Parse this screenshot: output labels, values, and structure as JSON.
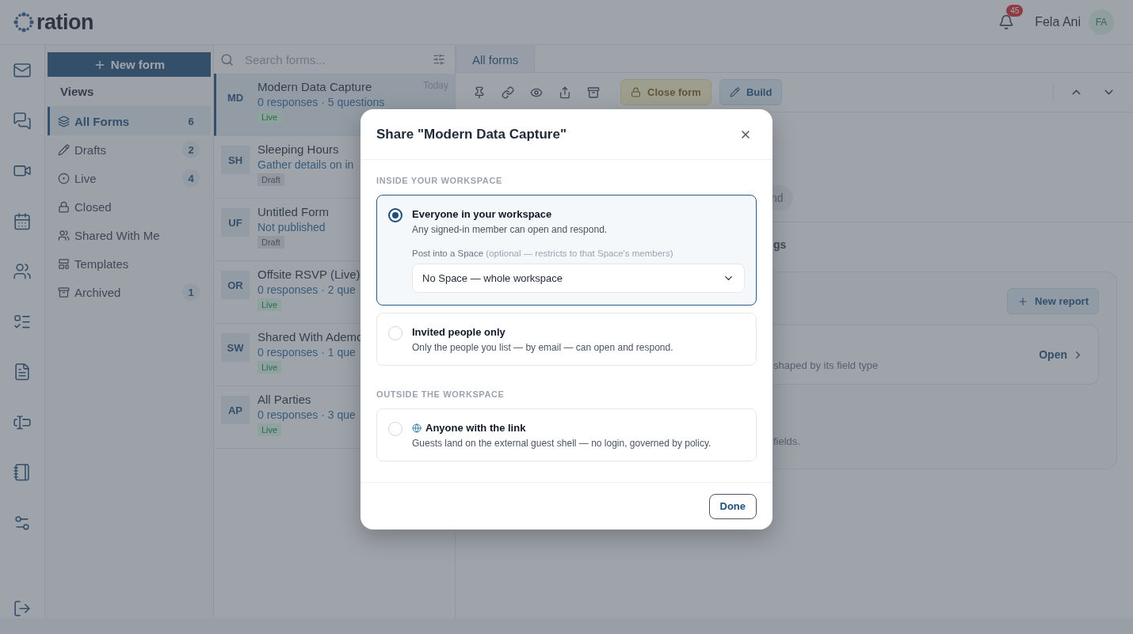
{
  "app": {
    "logo_text": "ration"
  },
  "header": {
    "notification_count": "45",
    "user": {
      "name": "Fela Ani",
      "initials": "FA"
    }
  },
  "sidebar": {
    "new_button": "New form",
    "heading": "Views",
    "items": [
      {
        "label": "All Forms",
        "count": "6",
        "selected": true
      },
      {
        "label": "Drafts",
        "count": "2",
        "selected": false
      },
      {
        "label": "Live",
        "count": "4",
        "selected": false
      },
      {
        "label": "Closed",
        "selected": false
      },
      {
        "label": "Shared With Me",
        "selected": false
      },
      {
        "label": "Templates",
        "selected": false
      },
      {
        "label": "Archived",
        "count": "1",
        "selected": false
      }
    ]
  },
  "form_list": {
    "search_placeholder": "Search forms...",
    "rows": [
      {
        "initials": "MD",
        "title": "Modern Data Capture",
        "subtitle": "0 responses · 5 questions",
        "date": "Today",
        "status": "Live",
        "kind": "live",
        "selected": true
      },
      {
        "initials": "SH",
        "title": "Sleeping Hours",
        "subtitle": "Gather details on in",
        "status": "Draft",
        "kind": "draft",
        "selected": false
      },
      {
        "initials": "UF",
        "title": "Untitled Form",
        "subtitle": "Not published",
        "status": "Draft",
        "kind": "draft",
        "selected": false
      },
      {
        "initials": "OR",
        "title": "Offsite RSVP (Live)",
        "subtitle": "0 responses · 2 que",
        "status": "Live",
        "kind": "live",
        "selected": false
      },
      {
        "initials": "SW",
        "title": "Shared With Ademo",
        "subtitle": "0 responses · 1 que",
        "status": "Live",
        "kind": "live",
        "selected": false
      },
      {
        "initials": "AP",
        "title": "All Parties",
        "subtitle": "0 responses · 3 que",
        "status": "Live",
        "kind": "live",
        "selected": false
      }
    ]
  },
  "main": {
    "tabs": [
      {
        "label": "All forms",
        "selected": true
      }
    ],
    "toolbar": {
      "close_button": "Close form",
      "build_button": "Build"
    },
    "pill_text": "nd",
    "section_text": "gs",
    "reports": {
      "new_button": "New report",
      "item_description": "shaped by its field type",
      "open_link": "Open",
      "note": "fields."
    }
  },
  "dialog": {
    "title": "Share \"Modern Data Capture\"",
    "sections": [
      {
        "heading": "INSIDE YOUR WORKSPACE",
        "options": [
          {
            "kind": "plain",
            "label": "Everyone in your workspace",
            "description": "Any signed-in member can open and respond.",
            "selected": true,
            "space": {
              "label": "Post into a Space",
              "hint": "(optional — restricts to that Space's members)",
              "value": "No Space — whole workspace"
            }
          },
          {
            "kind": "plain",
            "label": "Invited people only",
            "description": "Only the people you list — by email — can open and respond.",
            "selected": false
          }
        ]
      },
      {
        "heading": "OUTSIDE THE WORKSPACE",
        "options": [
          {
            "kind": "public",
            "label": "Anyone with the link",
            "description": "Guests land on the external guest shell — no login, governed by policy.",
            "selected": false
          }
        ]
      }
    ],
    "done_button": "Done"
  }
}
